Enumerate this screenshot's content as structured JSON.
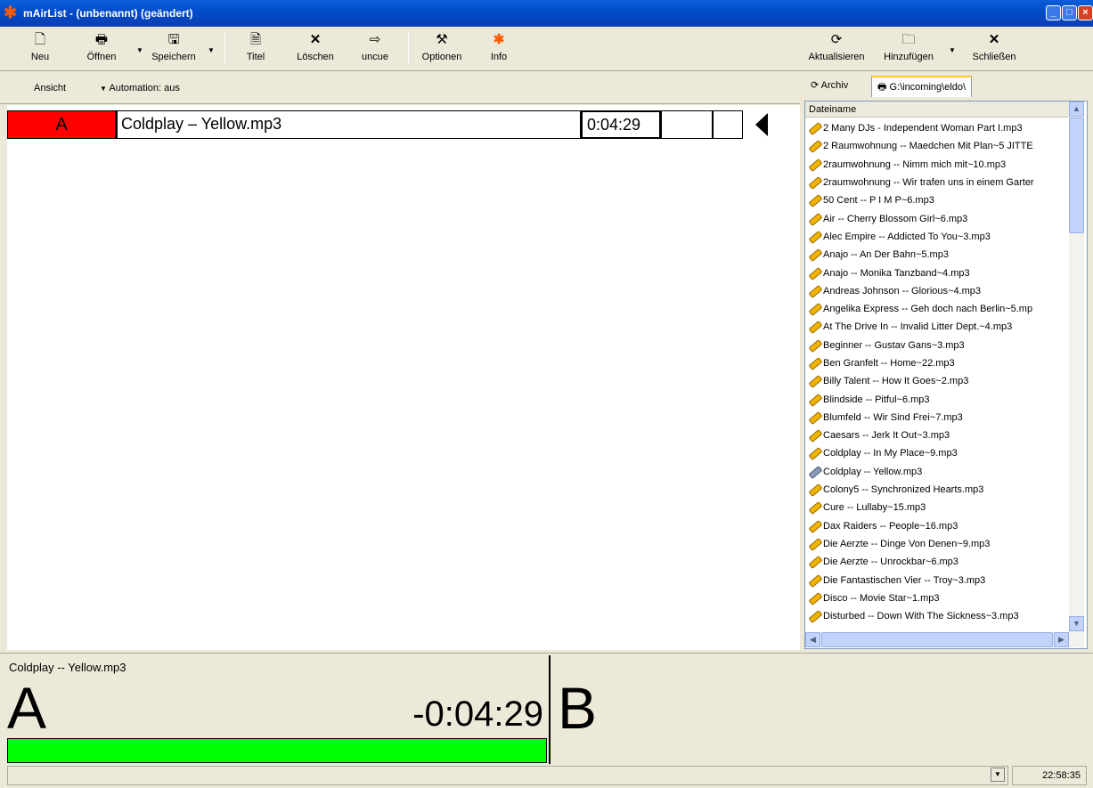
{
  "window": {
    "title": "mAirList - (unbenannt) (geändert)",
    "app_icon": "star-icon"
  },
  "toolbar": {
    "buttons": [
      {
        "label": "Neu",
        "icon": "new-file-icon"
      },
      {
        "label": "Öffnen",
        "icon": "open-icon"
      },
      {
        "label": "Speichern",
        "icon": "save-icon"
      },
      {
        "label": "Titel",
        "icon": "title-icon"
      },
      {
        "label": "Löschen",
        "icon": "delete-icon"
      },
      {
        "label": "uncue",
        "icon": "uncue-icon"
      },
      {
        "label": "Optionen",
        "icon": "options-icon"
      },
      {
        "label": "Info",
        "icon": "info-star-icon"
      }
    ]
  },
  "right_toolbar": {
    "buttons": [
      {
        "label": "Aktualisieren",
        "icon": "refresh-icon"
      },
      {
        "label": "Hinzufügen",
        "icon": "add-folder-icon"
      },
      {
        "label": "Schließen",
        "icon": "close-icon"
      }
    ]
  },
  "subbar": {
    "view_label": "Ansicht",
    "automation_label": "Automation: aus"
  },
  "playlist": {
    "rows": [
      {
        "player": "A",
        "title": "Coldplay – Yellow.mp3",
        "duration": "0:04:29"
      }
    ]
  },
  "tabs": [
    {
      "label": "Archiv",
      "icon": "refresh-icon"
    },
    {
      "label": "G:\\incoming\\eldo\\",
      "icon": "folder-icon"
    }
  ],
  "filelist": {
    "column": "Dateiname",
    "items": [
      "2 Many DJs - Independent Woman Part I.mp3",
      "2 Raumwohnung -- Maedchen Mit Plan~5 JITTE",
      "2raumwohnung -- Nimm mich mit~10.mp3",
      "2raumwohnung -- Wir trafen uns in einem Garter",
      "50 Cent -- P I M P~6.mp3",
      "Air -- Cherry Blossom Girl~6.mp3",
      "Alec Empire -- Addicted To You~3.mp3",
      "Anajo -- An Der Bahn~5.mp3",
      "Anajo -- Monika Tanzband~4.mp3",
      "Andreas Johnson -- Glorious~4.mp3",
      "Angelika Express -- Geh doch nach Berlin~5.mp",
      "At The Drive In -- Invalid Litter Dept.~4.mp3",
      "Beginner -- Gustav Gans~3.mp3",
      "Ben Granfelt -- Home~22.mp3",
      "Billy Talent -- How It Goes~2.mp3",
      "Blindside -- Pitful~6.mp3",
      "Blumfeld -- Wir Sind Frei~7.mp3",
      "Caesars -- Jerk It Out~3.mp3",
      "Coldplay -- In My Place~9.mp3",
      "Coldplay -- Yellow.mp3",
      "Colony5 -- Synchronized Hearts.mp3",
      "Cure -- Lullaby~15.mp3",
      "Dax Raiders -- People~16.mp3",
      "Die Aerzte -- Dinge Von Denen~9.mp3",
      "Die Aerzte -- Unrockbar~6.mp3",
      "Die Fantastischen Vier -- Troy~3.mp3",
      "Disco -- Movie Star~1.mp3",
      "Disturbed -- Down With The Sickness~3.mp3"
    ],
    "selected_index": 19
  },
  "player_a": {
    "title": "Coldplay -- Yellow.mp3",
    "letter": "A",
    "remaining": "-0:04:29",
    "progress": 1.0,
    "bar_color": "#00ff00"
  },
  "player_b": {
    "letter": "B"
  },
  "statusbar": {
    "clock": "22:58:35"
  },
  "colors": {
    "player_a_active": "#ff0000",
    "titlebar": "#0a5fd8"
  }
}
